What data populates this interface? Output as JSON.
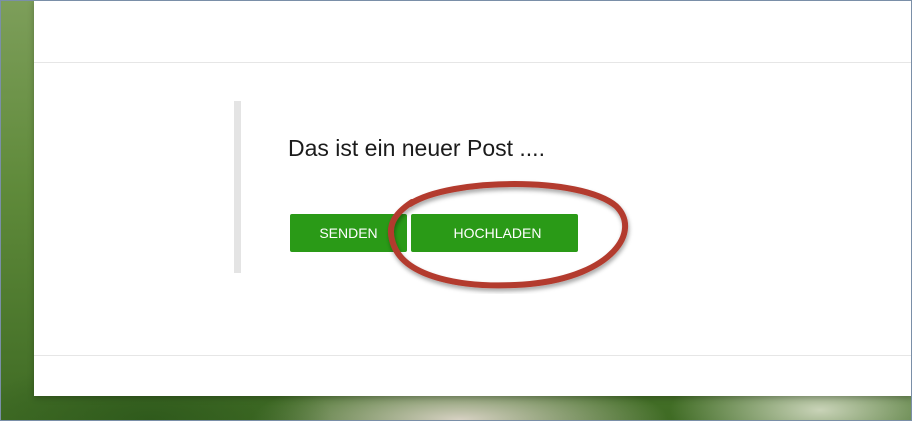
{
  "post": {
    "text": "Das ist ein neuer Post ...."
  },
  "buttons": {
    "send_label": "SENDEN",
    "upload_label": "HOCHLADEN"
  },
  "colors": {
    "button_green": "#2a9a17",
    "annotation_red": "#b33a2e",
    "card_background": "#ffffff"
  },
  "annotation": {
    "shape": "ellipse",
    "target": "upload-button"
  }
}
